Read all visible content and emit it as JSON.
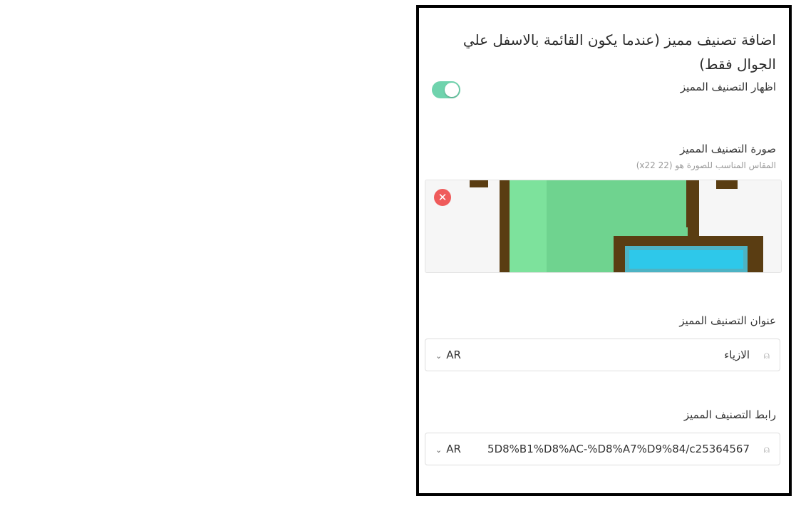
{
  "section": {
    "title": "اضافة تصنيف مميز (عندما يكون القائمة بالاسفل علي الجوال فقط)"
  },
  "show_toggle": {
    "label": "اظهار التصنيف المميز",
    "enabled": true,
    "color": "#6fd3ad"
  },
  "image": {
    "label": "صورة التصنيف المميز",
    "hint": "المقاس المناسب للصورة هو (22 x22)",
    "remove_icon": "close-icon"
  },
  "title_field": {
    "label": "عنوان التصنيف المميز",
    "value": "الازياء",
    "lang": "AR",
    "icon": "translate-icon"
  },
  "link_field": {
    "label": "رابط التصنيف المميز",
    "value": "5D8%B1%D8%AC-%D8%A7%D9%84/c25364567",
    "lang": "AR",
    "icon": "translate-icon"
  }
}
